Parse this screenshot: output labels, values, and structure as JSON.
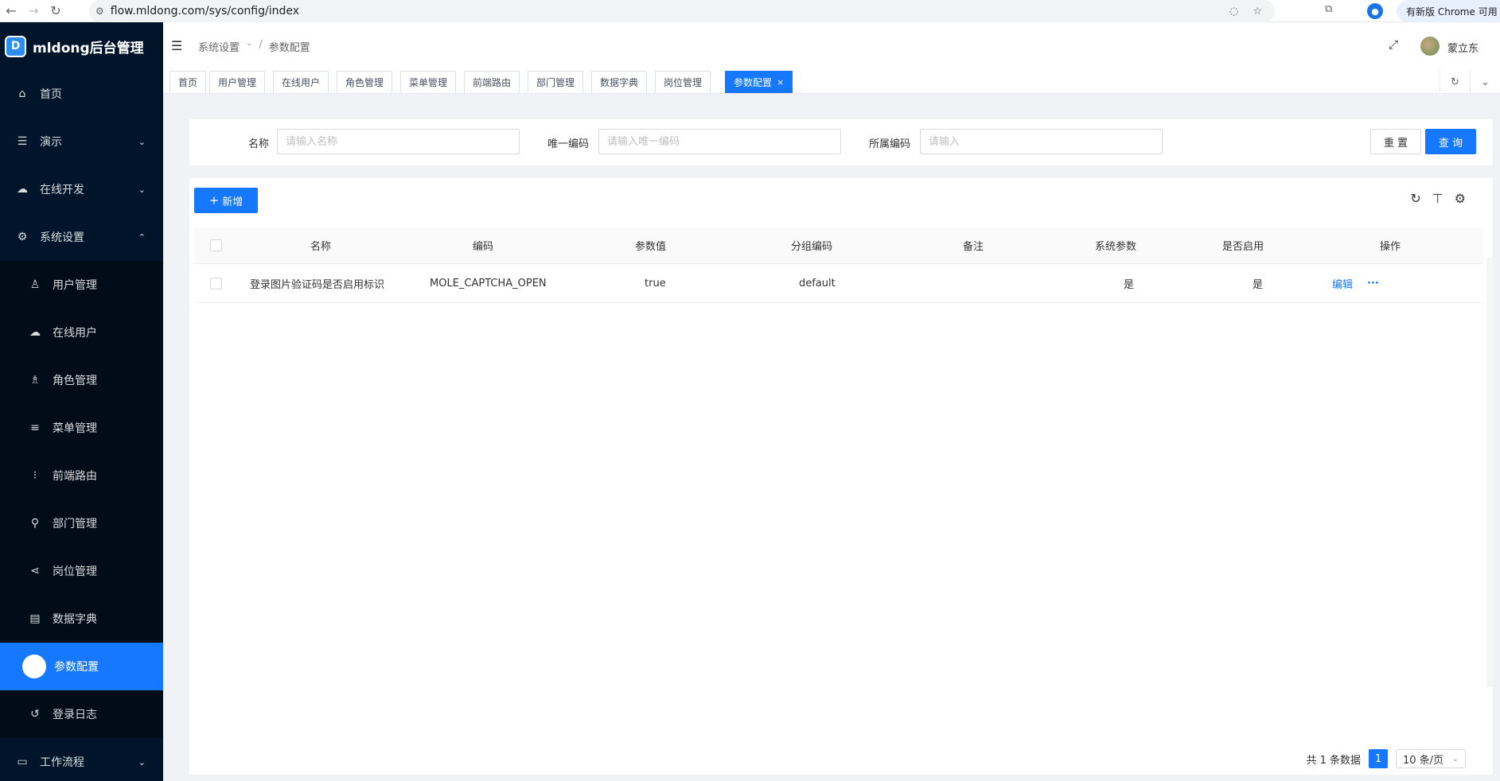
{
  "browser": {
    "url": "flow.mldong.com/sys/config/index",
    "update_notice": "有新版 Chrome 可用"
  },
  "sidebar": {
    "logo_mark": "D",
    "title": "mldong后台管理",
    "items": [
      {
        "label": "首页",
        "icon": "home-icon"
      },
      {
        "label": "演示",
        "icon": "list-icon"
      },
      {
        "label": "在线开发",
        "icon": "cloud-icon"
      },
      {
        "label": "系统设置",
        "icon": "gear-icon"
      },
      {
        "label": "用户管理",
        "icon": "user-icon"
      },
      {
        "label": "在线用户",
        "icon": "cloud-user-icon"
      },
      {
        "label": "角色管理",
        "icon": "role-icon"
      },
      {
        "label": "菜单管理",
        "icon": "menu-icon"
      },
      {
        "label": "前端路由",
        "icon": "route-icon"
      },
      {
        "label": "部门管理",
        "icon": "tree-icon"
      },
      {
        "label": "岗位管理",
        "icon": "share-icon"
      },
      {
        "label": "数据字典",
        "icon": "book-icon"
      },
      {
        "label": "参数配置",
        "icon": "circle-icon"
      },
      {
        "label": "登录日志",
        "icon": "history-icon"
      },
      {
        "label": "工作流程",
        "icon": "laptop-icon"
      }
    ]
  },
  "header": {
    "breadcrumb_parent": "系统设置",
    "breadcrumb_sep": "/",
    "breadcrumb_current": "参数配置",
    "username": "蒙立东"
  },
  "tabs": [
    "首页",
    "用户管理",
    "在线用户",
    "角色管理",
    "菜单管理",
    "前端路由",
    "部门管理",
    "数据字典",
    "岗位管理",
    "参数配置"
  ],
  "tab_close": "×",
  "search": {
    "name_label": "名称",
    "name_placeholder": "请输入名称",
    "code_label": "唯一编码",
    "code_placeholder": "请输入唯一编码",
    "group_label": "所属编码",
    "group_placeholder": "请输入",
    "reset_label": "重 置",
    "query_label": "查 询"
  },
  "table": {
    "add_label": "新增",
    "add_glyph": "+",
    "columns": [
      "名称",
      "编码",
      "参数值",
      "分组编码",
      "备注",
      "系统参数",
      "是否启用",
      "操作"
    ],
    "rows": [
      {
        "name": "登录图片验证码是否启用标识",
        "code": "MOLE_CAPTCHA_OPEN",
        "value": "true",
        "group": "default",
        "remark": "",
        "system": "是",
        "enabled": "是",
        "edit_label": "编辑",
        "more_label": "···"
      }
    ]
  },
  "pagination": {
    "total_text": "共 1 条数据",
    "current_page": "1",
    "page_size": "10 条/页"
  },
  "colors": {
    "sidebar_bg": "#001529",
    "primary": "#1677ff"
  }
}
